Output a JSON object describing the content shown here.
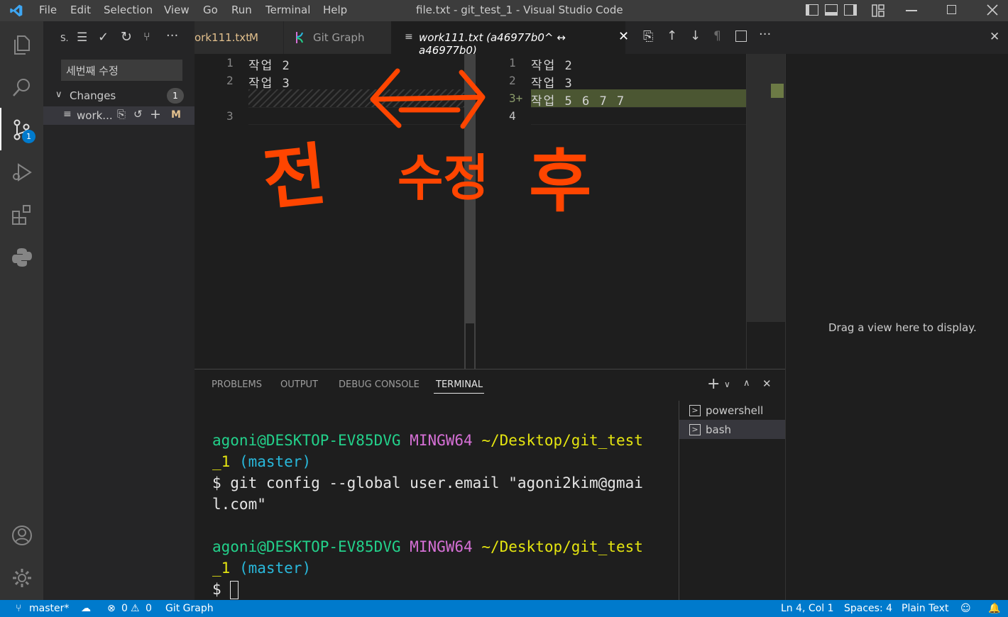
{
  "titlebar": {
    "menu": [
      "File",
      "Edit",
      "Selection",
      "View",
      "Go",
      "Run",
      "Terminal",
      "Help"
    ],
    "title": "file.txt - git_test_1 - Visual Studio Code"
  },
  "sidebar": {
    "header_label": "S.",
    "commit_message": "세번째 수정",
    "changes_label": "Changes",
    "changes_count": "1",
    "file_name": "work...",
    "file_status": "M"
  },
  "tabs": [
    {
      "label": "ork111.txt",
      "status": "M"
    },
    {
      "label": "Git Graph"
    },
    {
      "label": "work111.txt (a46977b0^ ↔ a46977b0)"
    }
  ],
  "diff": {
    "left_lines": [
      {
        "num": "1",
        "text": "작업 2"
      },
      {
        "num": "2",
        "text": "작업 3"
      },
      {
        "num": "3",
        "text": ""
      }
    ],
    "right_lines": [
      {
        "num": "1",
        "text": "작업 2"
      },
      {
        "num": "2",
        "text": "작업 3"
      },
      {
        "num": "3+",
        "text": "작업 5 6 7 7"
      },
      {
        "num": "4",
        "text": ""
      }
    ]
  },
  "annotations": {
    "before": "전",
    "modified": "수정",
    "after": "후"
  },
  "panel": {
    "tabs": [
      "PROBLEMS",
      "OUTPUT",
      "DEBUG CONSOLE",
      "TERMINAL"
    ],
    "terminals": [
      "powershell",
      "bash"
    ],
    "prompt_user": "agoni@DESKTOP-EV85DVG",
    "prompt_env": "MINGW64",
    "prompt_path_1": "~/Desktop/git_test",
    "prompt_path_2": "_1",
    "prompt_branch": "(master)",
    "command_1": "$ git config --global user.email \"agoni2kim@gmai",
    "command_2": "l.com\"",
    "prompt_symbol": "$"
  },
  "right_panel": {
    "empty_message": "Drag a view here to display."
  },
  "statusbar": {
    "branch": "master*",
    "errors": "0",
    "warnings": "0",
    "git_graph": "Git Graph",
    "position": "Ln 4, Col 1",
    "spaces": "Spaces: 4",
    "language": "Plain Text"
  },
  "colors": {
    "accent": "#007acc",
    "annotation": "#ff4500",
    "term_green": "#23d18b",
    "term_magenta": "#d670d6",
    "term_yellow": "#e5e510",
    "term_cyan": "#29b8db",
    "added_line": "#4b5632"
  }
}
